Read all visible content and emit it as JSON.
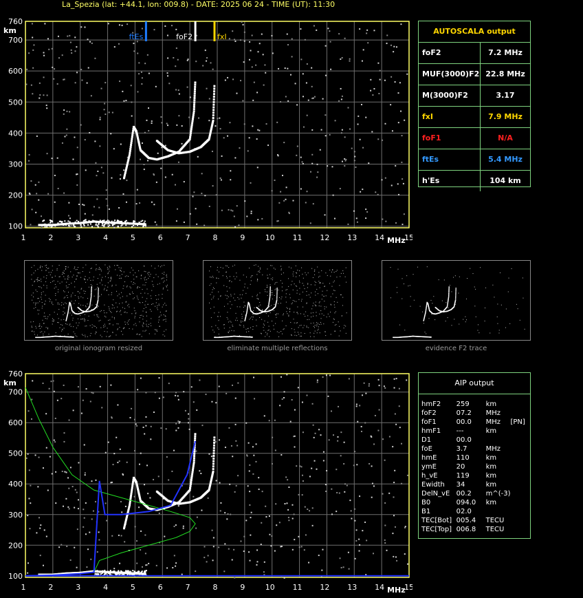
{
  "header": {
    "text": "La_Spezia (lat: +44.1, lon: 009.8) - DATE: 2025 06 24 - TIME (UT): 11:30"
  },
  "axes": {
    "y_ticks": [
      "760",
      "700",
      "600",
      "500",
      "400",
      "300",
      "200",
      "100"
    ],
    "y_unit": "km",
    "x_ticks": [
      "1",
      "2",
      "3",
      "4",
      "5",
      "6",
      "7",
      "8",
      "9",
      "10",
      "11",
      "12",
      "13",
      "14",
      "15"
    ],
    "x_unit": "MHz"
  },
  "markers": {
    "ftes": "ftEs",
    "fof2": "foF2",
    "fxl": "fxI"
  },
  "colors": {
    "grid": "#6f6f6f",
    "axis": "#ffff66",
    "panel_border": "#7fd47f",
    "ftes": "#1e7cff",
    "fxl": "#ffd700",
    "profile_green": "#22dd22",
    "profile_blue": "#2233ff",
    "red": "#ff2020",
    "gold": "#ffd700",
    "blue_text": "#3399ff"
  },
  "autoscala": {
    "title": "AUTOSCALA output",
    "rows": [
      {
        "k": "foF2",
        "v": "7.2 MHz",
        "kc": "#ffffff",
        "vc": "#ffffff"
      },
      {
        "k": "MUF(3000)F2",
        "v": "22.8 MHz",
        "kc": "#ffffff",
        "vc": "#ffffff"
      },
      {
        "k": "M(3000)F2",
        "v": "3.17",
        "kc": "#ffffff",
        "vc": "#ffffff"
      },
      {
        "k": "fxI",
        "v": "7.9 MHz",
        "kc": "#ffd700",
        "vc": "#ffd700"
      },
      {
        "k": "foF1",
        "v": "N/A",
        "kc": "#ff2020",
        "vc": "#ff2020"
      },
      {
        "k": "ftEs",
        "v": "5.4 MHz",
        "kc": "#3399ff",
        "vc": "#3399ff"
      },
      {
        "k": "h'Es",
        "v": "104     km",
        "kc": "#ffffff",
        "vc": "#ffffff"
      }
    ]
  },
  "aip": {
    "title": "AIP output",
    "rows": [
      [
        "hmF2",
        "259",
        "km",
        ""
      ],
      [
        "foF2",
        "07.2",
        "MHz",
        ""
      ],
      [
        "foF1",
        "00.0",
        "MHz",
        "[PN]"
      ],
      [
        "hmF1",
        "---",
        "km",
        ""
      ],
      [
        "D1",
        "00.0",
        "",
        ""
      ],
      [
        "foE",
        "3.7",
        "MHz",
        ""
      ],
      [
        "hmE",
        "110",
        "km",
        ""
      ],
      [
        "ymE",
        "20",
        "km",
        ""
      ],
      [
        "h_vE",
        "119",
        "km",
        ""
      ],
      [
        "Ewidth",
        "34",
        "km",
        ""
      ],
      [
        "DelN_vE",
        "00.2",
        "m^(-3)",
        ""
      ],
      [
        "B0",
        "094.0",
        "km",
        ""
      ],
      [
        "B1",
        "02.0",
        "",
        ""
      ],
      [
        "TEC[Bot]",
        "005.4",
        "TECU",
        ""
      ],
      [
        "TEC[Top]",
        "006.8",
        "TECU",
        ""
      ]
    ]
  },
  "thumbnails": [
    {
      "caption": "original ionogram resized"
    },
    {
      "caption": "eliminate multiple reflections"
    },
    {
      "caption": "evidence F2 trace"
    }
  ],
  "chart_data": [
    {
      "type": "scatter",
      "title": "La_Spezia (lat: +44.1, lon: 009.8) - DATE: 2025 06 24 - TIME (UT): 11:30",
      "xlabel": "MHz",
      "ylabel": "km",
      "xlim": [
        1,
        15
      ],
      "ylim": [
        95,
        760
      ],
      "grid": true,
      "series": [
        {
          "name": "ordinary trace",
          "x": [
            4.6,
            4.8,
            4.95,
            5.05,
            5.2,
            5.5,
            5.8,
            6.2,
            6.6,
            7.0,
            7.15,
            7.2
          ],
          "y": [
            255,
            330,
            420,
            405,
            345,
            320,
            315,
            325,
            340,
            380,
            470,
            570
          ]
        },
        {
          "name": "extraordinary trace",
          "x": [
            5.8,
            6.2,
            6.6,
            7.0,
            7.4,
            7.7,
            7.85,
            7.9
          ],
          "y": [
            375,
            345,
            335,
            340,
            355,
            380,
            440,
            560
          ]
        },
        {
          "name": "Es trace",
          "x": [
            1.5,
            2.0,
            2.5,
            3.0,
            3.5,
            4.0,
            4.5,
            5.0,
            5.4
          ],
          "y": [
            104,
            104,
            108,
            110,
            115,
            112,
            110,
            108,
            106
          ]
        }
      ],
      "markers": [
        {
          "label": "ftEs",
          "x": 5.4
        },
        {
          "label": "foF2",
          "x": 7.2
        },
        {
          "label": "fxI",
          "x": 7.9
        }
      ]
    },
    {
      "type": "line",
      "xlabel": "MHz",
      "ylabel": "km",
      "xlim": [
        1,
        15
      ],
      "ylim": [
        95,
        760
      ],
      "series": [
        {
          "name": "electron density profile",
          "x": [
            1.0,
            1.5,
            2.0,
            2.5,
            3.0,
            3.5,
            3.7,
            4.5,
            5.5,
            6.5,
            7.0,
            7.2,
            7.0,
            6.3,
            5.5,
            4.5,
            3.5,
            2.7,
            2.0,
            1.5,
            1.0
          ],
          "y": [
            100,
            101,
            102,
            104,
            107,
            112,
            150,
            175,
            200,
            225,
            245,
            270,
            290,
            310,
            330,
            355,
            380,
            430,
            520,
            610,
            715
          ]
        },
        {
          "name": "true height profile",
          "x": [
            1.0,
            2.0,
            3.0,
            3.5,
            3.7,
            3.9,
            4.5,
            5.5,
            6.3,
            6.9,
            7.2
          ],
          "y": [
            100,
            102,
            107,
            112,
            410,
            300,
            300,
            310,
            330,
            430,
            540
          ]
        }
      ]
    }
  ]
}
